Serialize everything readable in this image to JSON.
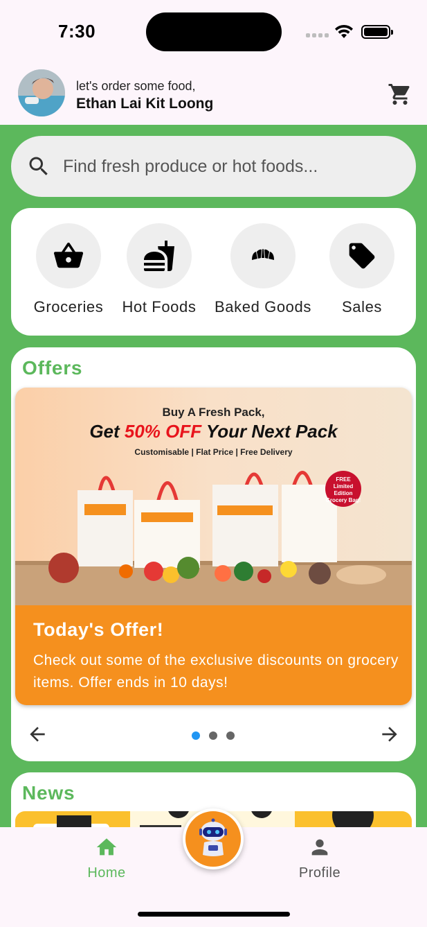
{
  "status_bar": {
    "time": "7:30"
  },
  "header": {
    "greeting": "let's order some food,",
    "user_name": "Ethan Lai Kit Loong",
    "cart_icon": "shopping-cart-icon"
  },
  "search": {
    "placeholder": "Find fresh produce or hot foods..."
  },
  "categories": [
    {
      "label": "Groceries",
      "icon": "shopping-basket-icon"
    },
    {
      "label": "Hot Foods",
      "icon": "fast-food-icon"
    },
    {
      "label": "Baked Goods",
      "icon": "croissant-icon"
    },
    {
      "label": "Sales",
      "icon": "tag-icon"
    }
  ],
  "offers": {
    "section_title": "Offers",
    "banner": {
      "line1": "Buy A Fresh Pack,",
      "line2_prefix": "Get ",
      "line2_highlight": "50% OFF",
      "line2_suffix": " Your Next Pack",
      "line3": "Customisable | Flat Price | Free Delivery",
      "badge_line1": "FREE",
      "badge_line2": "Limited Edition",
      "badge_line3": "Grocery Bag!"
    },
    "title": "Today's Offer!",
    "description": "Check out some of the exclusive discounts on grocery items. Offer ends in 10 days!",
    "carousel": {
      "slide_count": 3,
      "active_index": 0
    }
  },
  "news": {
    "section_title": "News"
  },
  "bottom_nav": {
    "home_label": "Home",
    "profile_label": "Profile",
    "assistant_icon": "robot-assistant-icon"
  },
  "colors": {
    "brand_green": "#5cb85c",
    "offer_orange": "#f5901e",
    "active_dot": "#2196f3"
  }
}
